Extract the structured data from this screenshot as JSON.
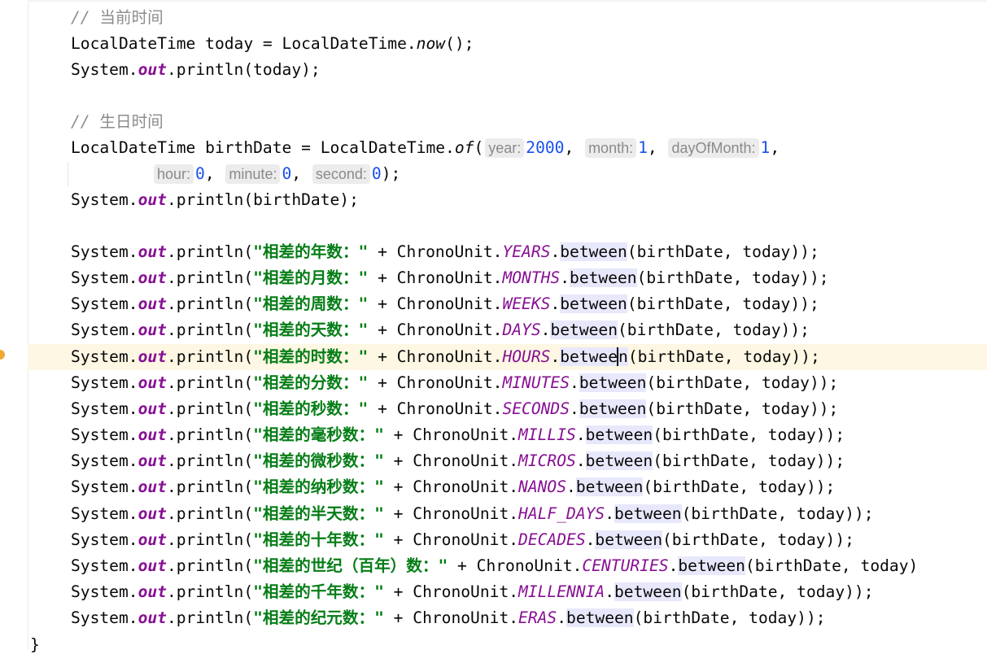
{
  "editor": {
    "comment_now": "// 当前时间",
    "now_line": {
      "prefix": "LocalDateTime today = LocalDateTime.",
      "method": "now",
      "suffix": "();"
    },
    "comment_birth": "// 生日时间",
    "of_line": {
      "prefix": "LocalDateTime birthDate = LocalDateTime.",
      "method": "of",
      "open": "(",
      "hint_year": "year:",
      "year": "2000",
      "hint_month": "month:",
      "month": "1",
      "hint_day": "dayOfMonth:",
      "day": "1",
      "hint_hour": "hour:",
      "hour": "0",
      "hint_minute": "minute:",
      "minute": "0",
      "hint_second": "second:",
      "second": "0",
      "close": ");"
    },
    "system": "System.",
    "out": "out",
    "println": ".println(",
    "println_today": ".println(today);",
    "println_birth": ".println(birthDate);",
    "plus_chrono": " + ChronoUnit.",
    "between": "between",
    "args": "(birthDate, today));",
    "args_truncated": "(birthDate, today)",
    "lines": [
      {
        "label": "\"相差的年数：\"",
        "unit": "YEARS"
      },
      {
        "label": "\"相差的月数：\"",
        "unit": "MONTHS"
      },
      {
        "label": "\"相差的周数：\"",
        "unit": "WEEKS"
      },
      {
        "label": "\"相差的天数：\"",
        "unit": "DAYS"
      },
      {
        "label": "\"相差的时数：\"",
        "unit": "HOURS"
      },
      {
        "label": "\"相差的分数：\"",
        "unit": "MINUTES"
      },
      {
        "label": "\"相差的秒数：\"",
        "unit": "SECONDS"
      },
      {
        "label": "\"相差的毫秒数：\"",
        "unit": "MILLIS"
      },
      {
        "label": "\"相差的微秒数：\"",
        "unit": "MICROS"
      },
      {
        "label": "\"相差的纳秒数：\"",
        "unit": "NANOS"
      },
      {
        "label": "\"相差的半天数：\"",
        "unit": "HALF_DAYS"
      },
      {
        "label": "\"相差的十年数：\"",
        "unit": "DECADES"
      },
      {
        "label": "\"相差的世纪（百年）数：\"",
        "unit": "CENTURIES"
      },
      {
        "label": "\"相差的千年数：\"",
        "unit": "MILLENNIA"
      },
      {
        "label": "\"相差的纪元数：\"",
        "unit": "ERAS"
      }
    ],
    "closing_brace": "}"
  },
  "colors": {
    "field": "#871094",
    "string": "#067d17",
    "number": "#1750eb",
    "comment": "#8c8c8c",
    "current_line": "#fdf7e4",
    "highlight": "#e8e8fc"
  }
}
